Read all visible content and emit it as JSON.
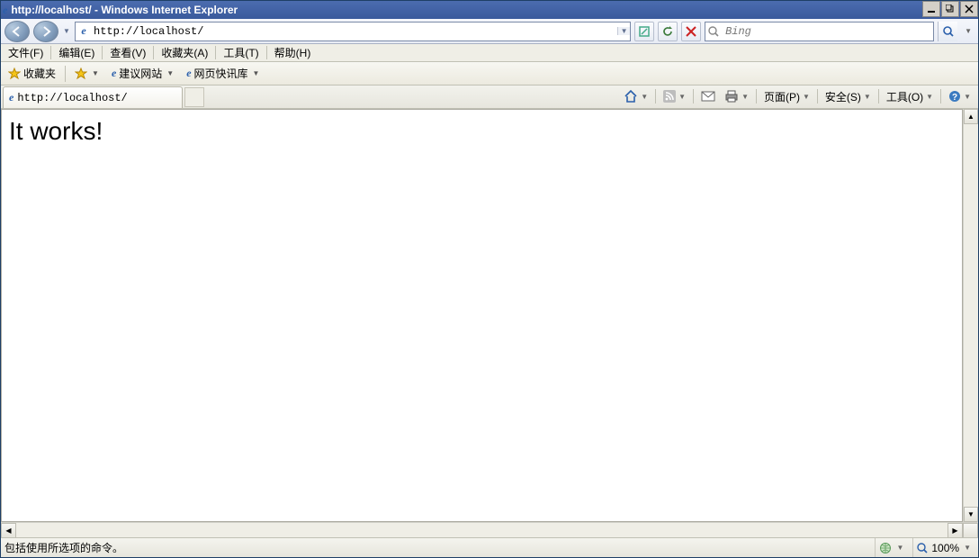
{
  "window": {
    "title": "http://localhost/ - Windows Internet Explorer"
  },
  "nav": {
    "url": "http://localhost/"
  },
  "search": {
    "placeholder": "Bing"
  },
  "menubar": {
    "file": "文件(F)",
    "edit": "编辑(E)",
    "view": "查看(V)",
    "fav": "收藏夹(A)",
    "tools": "工具(T)",
    "help": "帮助(H)"
  },
  "favbar": {
    "fav_label": "收藏夹",
    "suggested": "建议网站",
    "webslice": "网页快讯库"
  },
  "tab": {
    "title": "http://localhost/"
  },
  "cmdbar": {
    "page": "页面(P)",
    "safety": "安全(S)",
    "tools": "工具(O)"
  },
  "body": {
    "heading": "It works!"
  },
  "status": {
    "text": "包括使用所选项的命令。",
    "zoom": "100%"
  }
}
